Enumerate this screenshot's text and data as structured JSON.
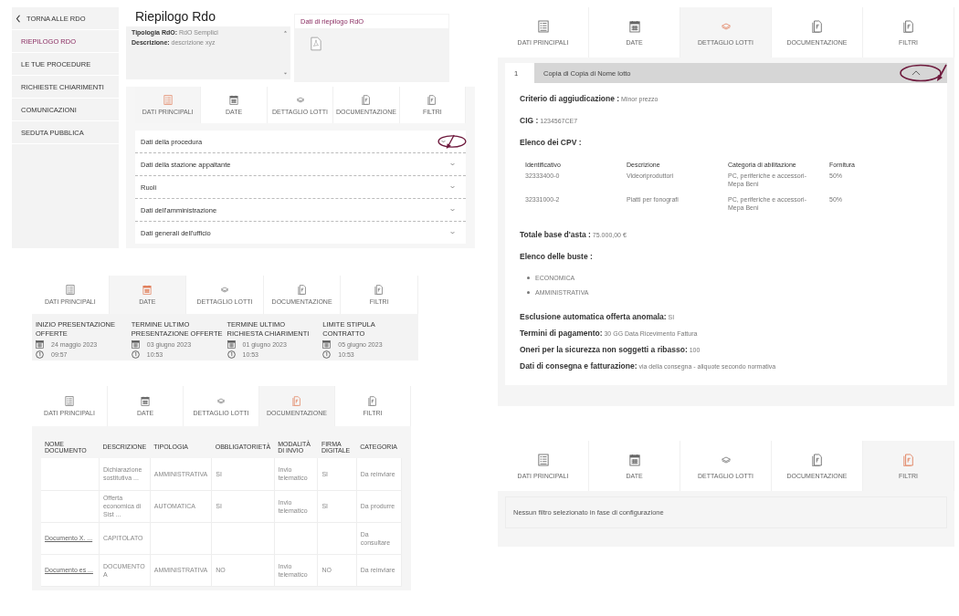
{
  "summary_screen": {
    "sidebar": {
      "back_link": "TORNA ALLE RDO",
      "items": [
        {
          "label": "RIEPILOGO RDO",
          "selected": true
        },
        {
          "label": "LE TUE PROCEDURE",
          "selected": false
        },
        {
          "label": "RICHIESTE CHIARIMENTI",
          "selected": false
        },
        {
          "label": "COMUNICAZIONI",
          "selected": false
        },
        {
          "label": "SEDUTA PUBBLICA",
          "selected": false
        }
      ]
    },
    "title": "Riepilogo Rdo",
    "info_box": {
      "lines": [
        "**Tipologia RdO:** RdO Semplici",
        "**Descrizione:** descrizione xyz"
      ]
    },
    "summary_card": {
      "title": "Dati di riepilogo RdO"
    },
    "tabs": [
      {
        "label": "DATI PRINCIPALI",
        "selected": true
      },
      {
        "label": "DATE",
        "selected": false
      },
      {
        "label": "DETTAGLIO LOTTI",
        "selected": false
      },
      {
        "label": "DOCUMENTAZIONE",
        "selected": false
      },
      {
        "label": "FILTRI",
        "selected": false
      }
    ],
    "accordion": [
      {
        "label": "Dati della procedura",
        "expanded": false
      },
      {
        "label": "Dati della stazione appaltante",
        "expanded": false
      },
      {
        "label": "Ruoli",
        "expanded": false
      },
      {
        "label": "Dati dell'amministrazione",
        "expanded": false
      },
      {
        "label": "Dati generali dell'ufficio",
        "expanded": false
      }
    ]
  },
  "dates_screen": {
    "tabs": [
      {
        "label": "DATI PRINCIPALI",
        "selected": false
      },
      {
        "label": "DATE",
        "selected": true
      },
      {
        "label": "DETTAGLIO LOTTI",
        "selected": false
      },
      {
        "label": "DOCUMENTAZIONE",
        "selected": false
      },
      {
        "label": "FILTRI",
        "selected": false
      }
    ],
    "dates": [
      {
        "label": "INIZIO PRESENTAZIONE OFFERTE",
        "date": "24 maggio 2023",
        "time": "09:57"
      },
      {
        "label": "TERMINE ULTIMO PRESENTAZIONE OFFERTE",
        "date": "03 giugno 2023",
        "time": "10:53"
      },
      {
        "label": "TERMINE ULTIMO RICHIESTA CHIARIMENTI",
        "date": "01 giugno 2023",
        "time": "10:53"
      },
      {
        "label": "LIMITE STIPULA CONTRATTO",
        "date": "05 giugno 2023",
        "time": "10:53"
      }
    ]
  },
  "documents_screen": {
    "tabs": [
      {
        "label": "DATI PRINCIPALI",
        "selected": false
      },
      {
        "label": "DATE",
        "selected": false
      },
      {
        "label": "DETTAGLIO LOTTI",
        "selected": false
      },
      {
        "label": "DOCUMENTAZIONE",
        "selected": true
      },
      {
        "label": "FILTRI",
        "selected": false
      }
    ],
    "table": {
      "columns": [
        "NOME DOCUMENTO",
        "DESCRIZIONE",
        "TIPOLOGIA",
        "OBBLIGATORIETÀ",
        "MODALITÀ DI INVIO",
        "FIRMA DIGITALE",
        "CATEGORIA"
      ],
      "rows": [
        [
          null,
          "Dichiarazione sostitutiva ...",
          "AMMINISTRATIVA",
          "SI",
          "Invio telematico",
          "SI",
          "Da reinviare"
        ],
        [
          null,
          "Offerta economica di Sist ...",
          "AUTOMATICA",
          "SI",
          "Invio telematico",
          "SI",
          "Da produrre"
        ],
        [
          "Documento X. ...",
          "CAPITOLATO",
          null,
          null,
          null,
          null,
          "Da consultare"
        ],
        [
          "Documento es ...",
          "DOCUMENTO A",
          "AMMINISTRATIVA",
          "NO",
          "Invio telematico",
          "NO",
          "Da reinviare"
        ]
      ]
    }
  },
  "lots_screen": {
    "tabs": [
      {
        "label": "DATI PRINCIPALI",
        "selected": false
      },
      {
        "label": "DATE",
        "selected": false
      },
      {
        "label": "DETTAGLIO LOTTI",
        "selected": true
      },
      {
        "label": "DOCUMENTAZIONE",
        "selected": false
      },
      {
        "label": "FILTRI",
        "selected": false
      }
    ],
    "lot": {
      "number": "1",
      "name": "Copia di Copia di Nome lotto",
      "expanded": true
    },
    "criterion": "**Criterio di aggiudicazione :** Minor prezzo",
    "cig": "**CIG :** 1234567CE7",
    "cpv_title": "Elenco dei CPV :",
    "cpv_table": {
      "columns": [
        "Identificativo",
        "Descrizione",
        "Categoria di abilitazione",
        "Fornitura"
      ],
      "rows": [
        [
          "32333400-0",
          "Videoriproduttori",
          "PC, periferiche e accessori-Mepa Beni",
          "50%"
        ],
        [
          "32331000-2",
          "Piatti per fonografi",
          "PC, periferiche e accessori-Mepa Beni",
          "50%"
        ]
      ]
    },
    "total": "**Totale base d'asta :** 75.000,00 €",
    "envelopes_title": "Elenco delle buste :",
    "envelopes": [
      "ECONOMICA",
      "AMMINISTRATIVA"
    ],
    "details": [
      "**Esclusione automatica offerta anomala:** SI",
      "**Termini di pagamento:** 30 GG Data Ricevimento Fattura",
      "**Oneri per la sicurezza non soggetti a ribasso:** 100",
      "**Dati di consegna e fatturazione:** via della consegna - aliquote secondo normativa"
    ]
  },
  "filters_screen": {
    "tabs": [
      {
        "label": "DATI PRINCIPALI",
        "selected": false
      },
      {
        "label": "DATE",
        "selected": false
      },
      {
        "label": "DETTAGLIO LOTTI",
        "selected": false
      },
      {
        "label": "DOCUMENTAZIONE",
        "selected": false
      },
      {
        "label": "FILTRI",
        "selected": true
      }
    ],
    "message": "Nessun filtro selezionato in fase di configurazione"
  }
}
